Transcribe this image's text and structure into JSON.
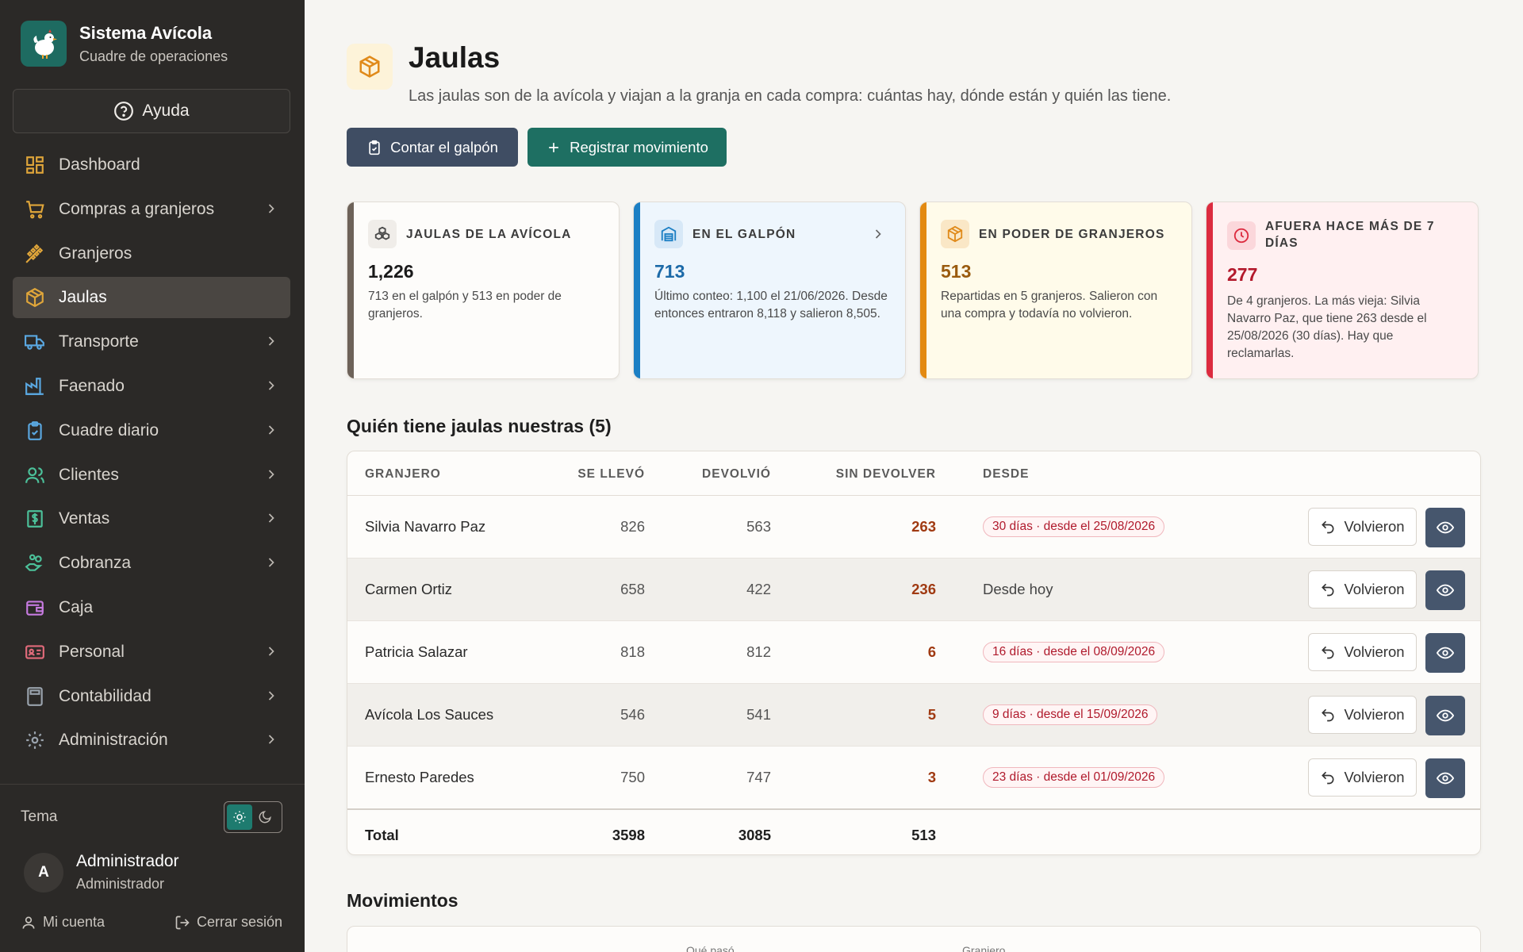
{
  "sidebar": {
    "brand": {
      "title": "Sistema Avícola",
      "subtitle": "Cuadre de operaciones"
    },
    "help_label": "Ayuda",
    "items": [
      {
        "label": "Dashboard",
        "icon": "dashboard-icon",
        "has_submenu": false,
        "color": "#e0a63a"
      },
      {
        "label": "Compras a granjeros",
        "icon": "cart-icon",
        "has_submenu": true,
        "color": "#e0a63a"
      },
      {
        "label": "Granjeros",
        "icon": "wheat-icon",
        "has_submenu": false,
        "color": "#e0a63a"
      },
      {
        "label": "Jaulas",
        "icon": "box-icon",
        "has_submenu": false,
        "active": true,
        "color": "#e0a63a"
      },
      {
        "label": "Transporte",
        "icon": "truck-icon",
        "has_submenu": true,
        "color": "#5aa7e0"
      },
      {
        "label": "Faenado",
        "icon": "factory-icon",
        "has_submenu": true,
        "color": "#5aa7e0"
      },
      {
        "label": "Cuadre diario",
        "icon": "clipboard-icon",
        "has_submenu": true,
        "color": "#5aa7e0"
      },
      {
        "label": "Clientes",
        "icon": "users-icon",
        "has_submenu": true,
        "color": "#4cc19a"
      },
      {
        "label": "Ventas",
        "icon": "receipt-icon",
        "has_submenu": true,
        "color": "#4cc19a"
      },
      {
        "label": "Cobranza",
        "icon": "hand-coins-icon",
        "has_submenu": true,
        "color": "#4cc19a"
      },
      {
        "label": "Caja",
        "icon": "wallet-icon",
        "has_submenu": false,
        "color": "#c77be0"
      },
      {
        "label": "Personal",
        "icon": "id-card-icon",
        "has_submenu": true,
        "color": "#e06a7a"
      },
      {
        "label": "Contabilidad",
        "icon": "calculator-icon",
        "has_submenu": true,
        "color": "#9aa3ad"
      },
      {
        "label": "Administración",
        "icon": "gear-icon",
        "has_submenu": true,
        "color": "#9aa3ad"
      }
    ],
    "theme_label": "Tema",
    "theme_selected": "light",
    "user": {
      "initial": "A",
      "name": "Administrador",
      "role": "Administrador"
    },
    "my_account_label": "Mi cuenta",
    "logout_label": "Cerrar sesión"
  },
  "page": {
    "title": "Jaulas",
    "subtitle": "Las jaulas son de la avícola y viajan a la granja en cada compra: cuántas hay, dónde están y quién las tiene.",
    "buttons": {
      "count": "Contar el galpón",
      "register": "Registrar movimiento"
    }
  },
  "cards": [
    {
      "label": "JAULAS DE LA AVÍCOLA",
      "value": "1,226",
      "desc": "713 en el galpón y 513 en poder de granjeros.",
      "icon": "boxes-icon"
    },
    {
      "label": "EN EL GALPÓN",
      "value": "713",
      "desc": "Último conteo: 1,100 el 21/06/2026. Desde entonces entraron 8,118 y salieron 8,505.",
      "icon": "warehouse-icon"
    },
    {
      "label": "EN PODER DE GRANJEROS",
      "value": "513",
      "desc": "Repartidas en 5 granjeros. Salieron con una compra y todavía no volvieron.",
      "icon": "package-icon"
    },
    {
      "label": "AFUERA HACE MÁS DE 7 DÍAS",
      "value": "277",
      "desc": "De 4 granjeros. La más vieja: Silvia Navarro Paz, que tiene 263 desde el 25/08/2026 (30 días). Hay que reclamarlas.",
      "icon": "clock-icon"
    }
  ],
  "holders": {
    "title": "Quién tiene jaulas nuestras (5)",
    "columns": {
      "farmer": "GRANJERO",
      "took": "SE LLEVÓ",
      "returned": "DEVOLVIÓ",
      "pending": "SIN DEVOLVER",
      "since": "DESDE"
    },
    "action_label": "Volvieron",
    "rows": [
      {
        "farmer": "Silvia Navarro Paz",
        "took": "826",
        "returned": "563",
        "pending": "263",
        "since": "30 días · desde el 25/08/2026",
        "since_is_pill": true
      },
      {
        "farmer": "Carmen Ortiz",
        "took": "658",
        "returned": "422",
        "pending": "236",
        "since": "Desde hoy",
        "since_is_pill": false
      },
      {
        "farmer": "Patricia Salazar",
        "took": "818",
        "returned": "812",
        "pending": "6",
        "since": "16 días · desde el 08/09/2026",
        "since_is_pill": true
      },
      {
        "farmer": "Avícola Los Sauces",
        "took": "546",
        "returned": "541",
        "pending": "5",
        "since": "9 días · desde el 15/09/2026",
        "since_is_pill": true
      },
      {
        "farmer": "Ernesto Paredes",
        "took": "750",
        "returned": "747",
        "pending": "3",
        "since": "23 días · desde el 01/09/2026",
        "since_is_pill": true
      }
    ],
    "total": {
      "label": "Total",
      "took": "3598",
      "returned": "3085",
      "pending": "513"
    }
  },
  "movements": {
    "title": "Movimientos",
    "columns": {
      "what": "Qué pasó",
      "farmer": "Granjero"
    }
  }
}
